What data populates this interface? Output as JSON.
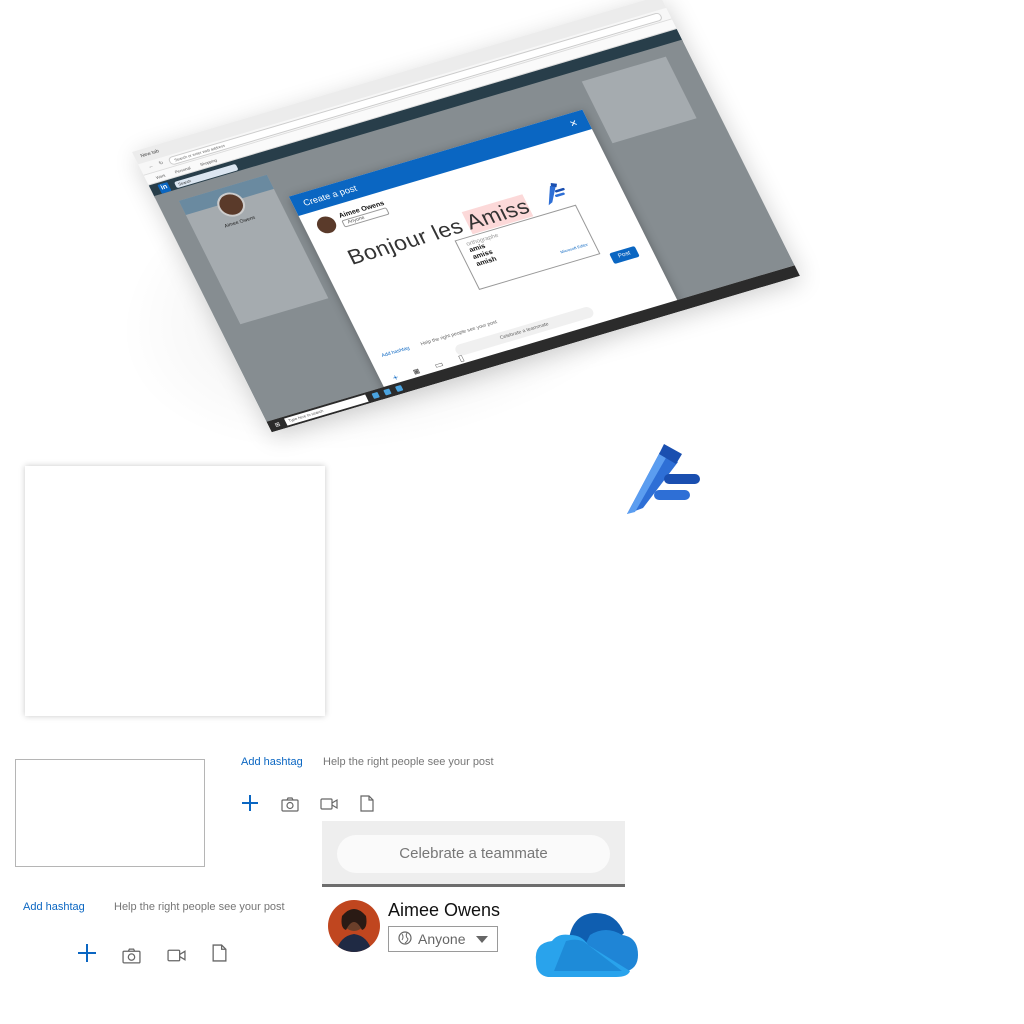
{
  "mockup": {
    "browser_tab": "New tab",
    "url_placeholder": "Search or enter web address",
    "favorites": [
      "Work",
      "Personal",
      "Shopping"
    ],
    "linkedin_logo": "in",
    "search_label": "Search",
    "profile_name": "Aimee Owens",
    "dialog": {
      "title": "Create a post",
      "user_name": "Aimee Owens",
      "audience": "Anyone",
      "text_before": "Bonjour les ",
      "text_misspelled": "Amiss",
      "suggestions_header": "orthographe",
      "suggestions": [
        "amis",
        "amiss",
        "amish"
      ],
      "editor_brand": "Microsoft Editor",
      "post_button": "Post",
      "add_hashtag": "Add hashtag",
      "hashtag_help": "Help the right people see your post",
      "celebrate": "Celebrate a teammate"
    },
    "taskbar_search": "Type here to search"
  },
  "composer_top": {
    "add_hashtag": "Add hashtag",
    "help": "Help the right people see your post"
  },
  "composer_bottom": {
    "add_hashtag": "Add hashtag",
    "help": "Help the right people see your post"
  },
  "celebrate": {
    "label": "Celebrate a teammate"
  },
  "user": {
    "name": "Aimee Owens",
    "audience": "Anyone"
  },
  "icons": {
    "add": "plus-icon",
    "photo": "camera-icon",
    "video": "video-icon",
    "document": "document-icon",
    "globe": "globe-icon",
    "editor": "microsoft-editor-pen-icon",
    "cloud": "onedrive-cloud-icon"
  },
  "colors": {
    "linkedin_blue": "#0a66c2",
    "editor_blue": "#2e6fd6",
    "onedrive_blue": "#0f6fc6"
  }
}
